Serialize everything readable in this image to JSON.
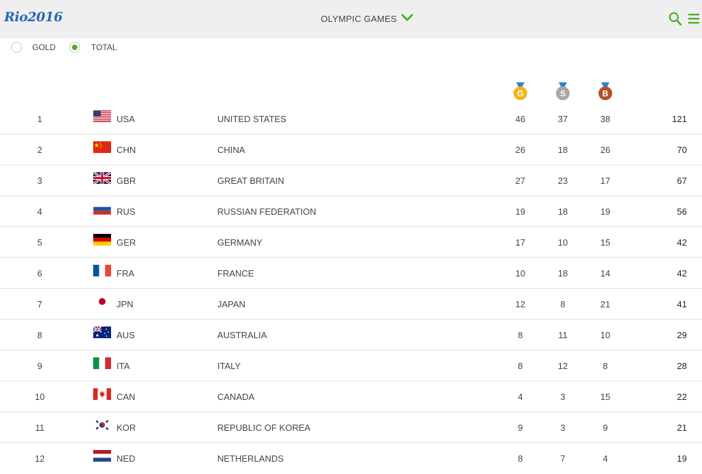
{
  "header": {
    "logo": "Rio2016",
    "title": "OLYMPIC GAMES"
  },
  "filters": [
    {
      "label": "GOLD",
      "selected": false
    },
    {
      "label": "TOTAL",
      "selected": true
    }
  ],
  "medal_columns": [
    {
      "letter": "G",
      "color": "#f2b51c"
    },
    {
      "letter": "S",
      "color": "#a7a7a7"
    },
    {
      "letter": "B",
      "color": "#b4512b"
    }
  ],
  "rows": [
    {
      "rank": "1",
      "code": "USA",
      "country": "UNITED STATES",
      "gold": "46",
      "silver": "37",
      "bronze": "38",
      "total": "121"
    },
    {
      "rank": "2",
      "code": "CHN",
      "country": "CHINA",
      "gold": "26",
      "silver": "18",
      "bronze": "26",
      "total": "70"
    },
    {
      "rank": "3",
      "code": "GBR",
      "country": "GREAT BRITAIN",
      "gold": "27",
      "silver": "23",
      "bronze": "17",
      "total": "67"
    },
    {
      "rank": "4",
      "code": "RUS",
      "country": "RUSSIAN FEDERATION",
      "gold": "19",
      "silver": "18",
      "bronze": "19",
      "total": "56"
    },
    {
      "rank": "5",
      "code": "GER",
      "country": "GERMANY",
      "gold": "17",
      "silver": "10",
      "bronze": "15",
      "total": "42"
    },
    {
      "rank": "6",
      "code": "FRA",
      "country": "FRANCE",
      "gold": "10",
      "silver": "18",
      "bronze": "14",
      "total": "42"
    },
    {
      "rank": "7",
      "code": "JPN",
      "country": "JAPAN",
      "gold": "12",
      "silver": "8",
      "bronze": "21",
      "total": "41"
    },
    {
      "rank": "8",
      "code": "AUS",
      "country": "AUSTRALIA",
      "gold": "8",
      "silver": "11",
      "bronze": "10",
      "total": "29"
    },
    {
      "rank": "9",
      "code": "ITA",
      "country": "ITALY",
      "gold": "8",
      "silver": "12",
      "bronze": "8",
      "total": "28"
    },
    {
      "rank": "10",
      "code": "CAN",
      "country": "CANADA",
      "gold": "4",
      "silver": "3",
      "bronze": "15",
      "total": "22"
    },
    {
      "rank": "11",
      "code": "KOR",
      "country": "REPUBLIC OF KOREA",
      "gold": "9",
      "silver": "3",
      "bronze": "9",
      "total": "21"
    },
    {
      "rank": "12",
      "code": "NED",
      "country": "NETHERLANDS",
      "gold": "8",
      "silver": "7",
      "bronze": "4",
      "total": "19"
    }
  ]
}
